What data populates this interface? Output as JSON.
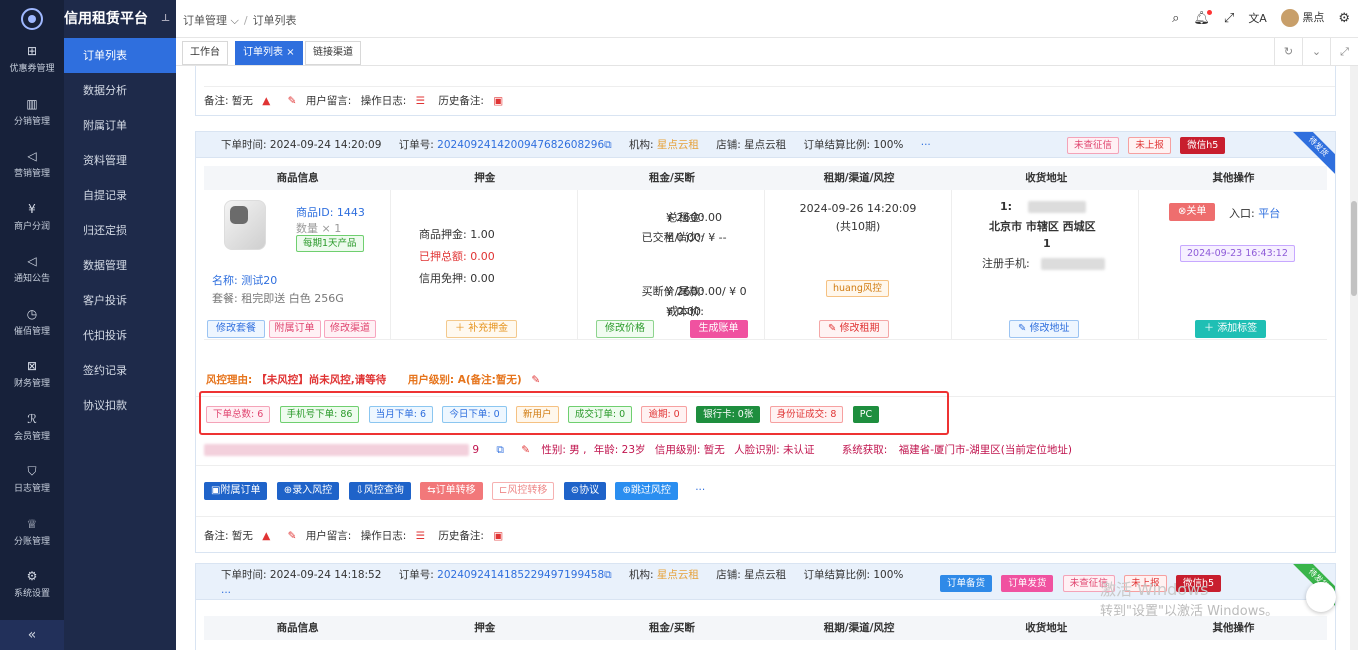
{
  "app": {
    "title": "信用租赁平台",
    "user": "黑点"
  },
  "colors": {
    "brand": "#2f6fde",
    "rail": "#17213a",
    "sidebar": "#1e2a4a",
    "danger": "#e03434"
  },
  "rail": [
    {
      "label": "优惠券管理",
      "icon": "gift-icon"
    },
    {
      "label": "分销管理",
      "icon": "chart-icon"
    },
    {
      "label": "营销管理",
      "icon": "megaphone-icon"
    },
    {
      "label": "商户分润",
      "icon": "yen-icon"
    },
    {
      "label": "通知公告",
      "icon": "bell-icon"
    },
    {
      "label": "催佰管理",
      "icon": "clock-icon"
    },
    {
      "label": "财务管理",
      "icon": "yen-box-icon"
    },
    {
      "label": "会员管理",
      "icon": "user-icon"
    },
    {
      "label": "日志管理",
      "icon": "shield-icon"
    },
    {
      "label": "分账管理",
      "icon": "crown-icon"
    },
    {
      "label": "系统设置",
      "icon": "gear-icon"
    }
  ],
  "sidebar": {
    "items": [
      "订单列表",
      "数据分析",
      "附属订单",
      "资料管理",
      "自提记录",
      "归还定损",
      "数据管理",
      "客户投诉",
      "代扣投诉",
      "签约记录",
      "协议扣款"
    ]
  },
  "breadcrumb": {
    "first": "订单管理",
    "second": "订单列表"
  },
  "tabs": [
    "工作台",
    "订单列表",
    "链接渠道"
  ],
  "prev": {
    "remark_label": "备注:",
    "remark": "暂无",
    "msg_label": "用户留言:",
    "log_label": "操作日志:",
    "history_label": "历史备注:"
  },
  "order1": {
    "time_label": "下单时间:",
    "time": "2024-09-24 14:20:09",
    "no_label": "订单号:",
    "no": "20240924142009476826082​96",
    "org_label": "机构:",
    "org": "星点云租",
    "shop_label": "店铺:",
    "shop": "星点云租",
    "ratio_label": "订单结算比例:",
    "ratio": "100%",
    "more": "···",
    "tags": [
      "未查征信",
      "未上报",
      "微信h5"
    ],
    "ribbon": "待发货",
    "columns": [
      "商品信息",
      "押金",
      "租金/买断",
      "租期/渠道/风控",
      "收货地址",
      "其他操作"
    ],
    "product": {
      "id_label": "商品ID:",
      "id": "1443",
      "qty": "数量 × 1",
      "badge": "每期1天产品",
      "name_label": "名称:",
      "name": "测试20",
      "pkg_label": "套餐:",
      "pkg": "租完即送 白色 256G"
    },
    "deposit": {
      "goods_label": "商品押金:",
      "goods": "1.00",
      "paid_label": "已押总额:",
      "paid": "0.00",
      "credit_label": "信用免押:",
      "credit": "0.00"
    },
    "rent": {
      "total_label": "总租金:",
      "total": "¥ 2600.00",
      "paid_label": "已交租/尚欠:",
      "paid": "¥ 0.00/ ¥ --",
      "buyout_label": "买断价/尾款:",
      "buyout": "¥ 2600.00/ ¥ 0",
      "cost_label": "成本价:",
      "cost": "¥ 0.00"
    },
    "period": {
      "date": "2024-09-26 14:20:09",
      "count": "(共10期)",
      "risk_tag": "huang风控"
    },
    "address": {
      "line1": "1:",
      "city": "北京市 市辖区 西城区",
      "line3": "1",
      "phone_label": "注册手机:"
    },
    "ops": {
      "close": "关单",
      "entry_label": "入口:",
      "entry": "平台",
      "date": "2024-09-23 16:43:12"
    },
    "buttons": {
      "edit_pkg": "修改套餐",
      "sub_order": "附属订单",
      "edit_channel": "修改渠道",
      "add_deposit": "补充押金",
      "edit_price": "修改价格",
      "gen_bill": "生成账单",
      "edit_period": "修改租期",
      "edit_addr": "修改地址",
      "add_tag": "添加标签"
    },
    "risk": {
      "label": "风控理由:",
      "text": "【未风控】尚未风控,请等待",
      "level_label": "用户级别:",
      "level": "A(备注:暂无)"
    },
    "stats": [
      "下单总数: 6",
      "手机号下单: 86",
      "当月下单: 6",
      "今日下单: 0",
      "新用户",
      "成交订单: 0",
      "逾期: 0",
      "银行卡: 0张",
      "身份证成交: 8",
      "PC"
    ],
    "user": {
      "num": "9",
      "gender": "性别: 男 ,",
      "age": "年龄: 23岁",
      "credit": "信用级别: 暂无",
      "face": "人脸识别: 未认证",
      "sys_label": "系统获取:",
      "location": "福建省-厦门市-湖里区(当前定位地址)"
    },
    "actions": [
      "附属订单",
      "录入风控",
      "风控查询",
      "订单转移",
      "风控转移",
      "协议",
      "跳过风控",
      "···"
    ],
    "remark_label": "备注:",
    "remark": "暂无",
    "msg_label": "用户留言:",
    "log_label": "操作日志:",
    "history_label": "历史备注:"
  },
  "order2": {
    "time_label": "下单时间:",
    "time": "2024-09-24 14:18:52",
    "no_label": "订单号:",
    "no": "20240924141852294971994​58",
    "org_label": "机构:",
    "org": "星点云租",
    "shop_label": "店铺:",
    "shop": "星点云租",
    "ratio_label": "订单结算比例:",
    "ratio": "100%",
    "more": "···",
    "tags": [
      "订单备货",
      "订单发货",
      "未查征信",
      "未上报",
      "微信h5"
    ],
    "ribbon": "待发货"
  },
  "watermark": {
    "line1": "激活 Windows",
    "line2": "转到\"设置\"以激活 Windows。"
  }
}
